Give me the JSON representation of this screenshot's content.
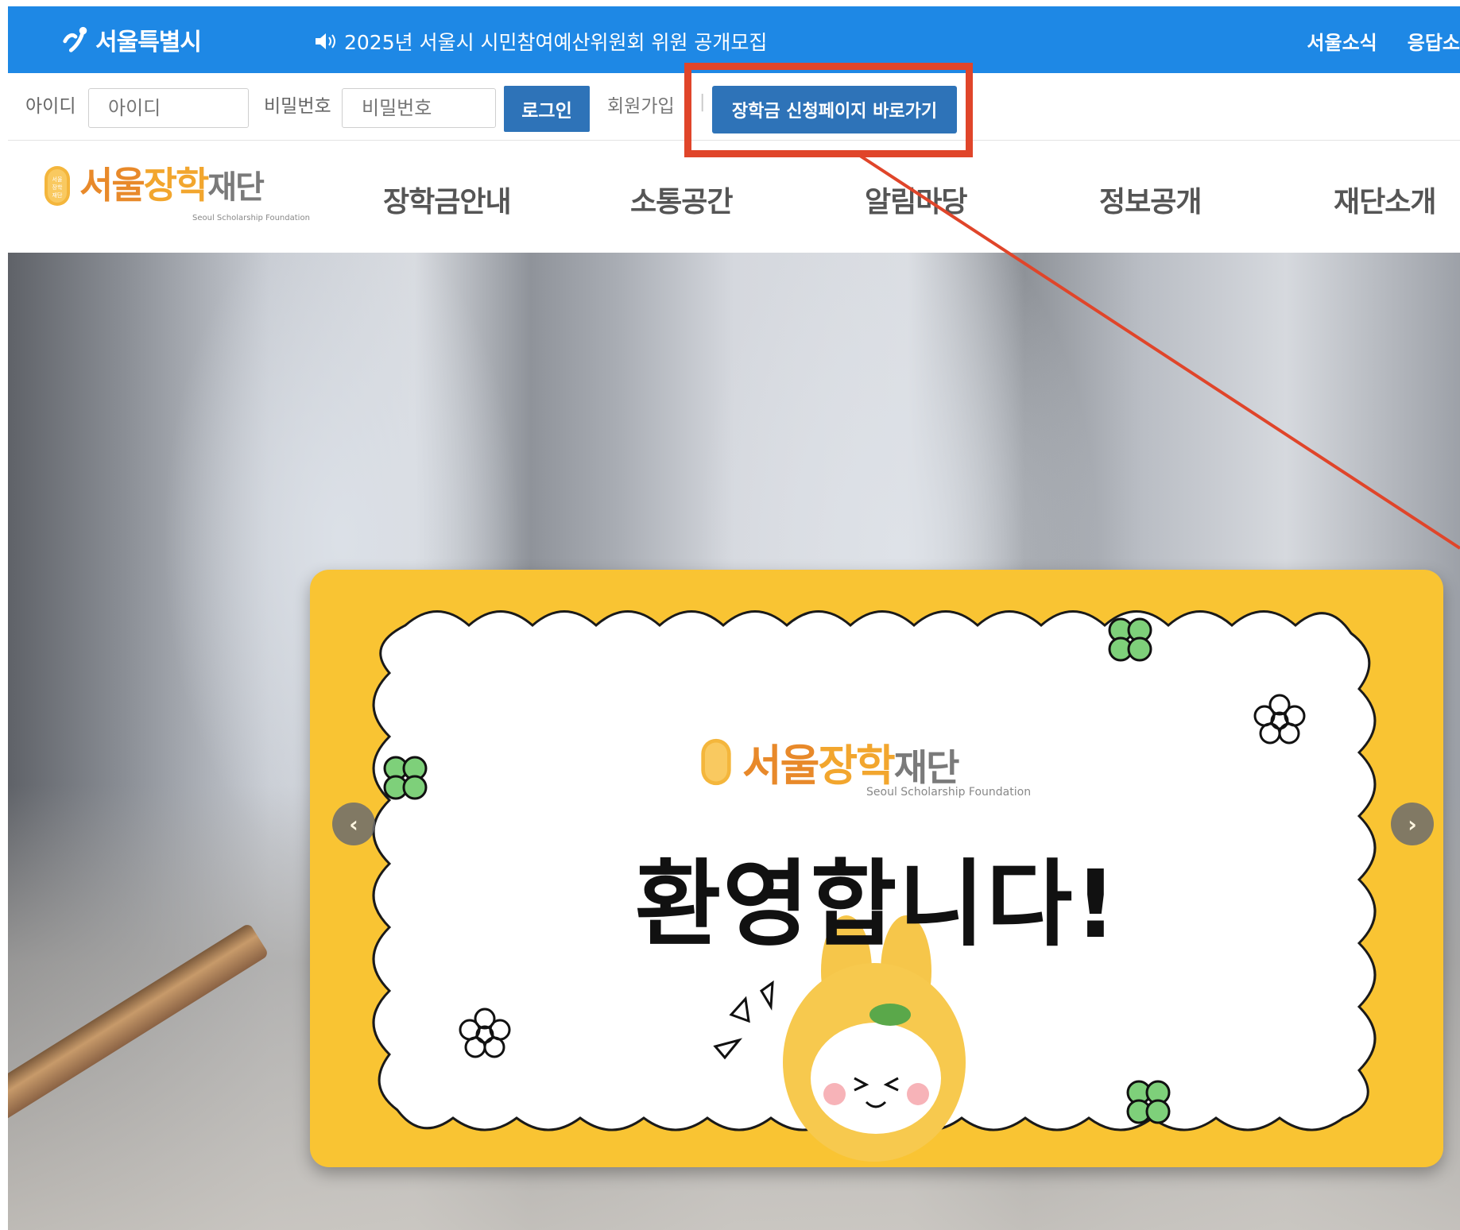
{
  "topbar": {
    "seoul_logo_text": "서울특별시",
    "notice": "2025년 서울시 시민참여예산위원회 위원 공개모집",
    "links": [
      "서울소식",
      "응답소"
    ],
    "color": "#1e88e5"
  },
  "login": {
    "id_label": "아이디",
    "id_placeholder": "아이디",
    "pw_label": "비밀번호",
    "pw_placeholder": "비밀번호",
    "login_button": "로그인",
    "join_link": "회원가입",
    "separator": "|",
    "scholarship_button": "장학금 신청페이지 바로가기"
  },
  "brand": {
    "wordmark_parts": [
      "서울",
      "장학",
      "재단"
    ],
    "subtitle": "Seoul Scholarship Foundation",
    "medal_icon": "seoul-scholarship-medal-icon"
  },
  "nav": {
    "items": [
      "장학금안내",
      "소통공간",
      "알림마당",
      "정보공개",
      "재단소개"
    ]
  },
  "slide": {
    "wordmark_parts": [
      "서울",
      "장학",
      "재단"
    ],
    "subtitle": "Seoul Scholarship Foundation",
    "welcome": "환영합니다!",
    "prev_icon": "chevron-left-icon",
    "next_icon": "chevron-right-icon",
    "background_color": "#f9c433"
  },
  "annotation": {
    "color": "#e0452a"
  }
}
